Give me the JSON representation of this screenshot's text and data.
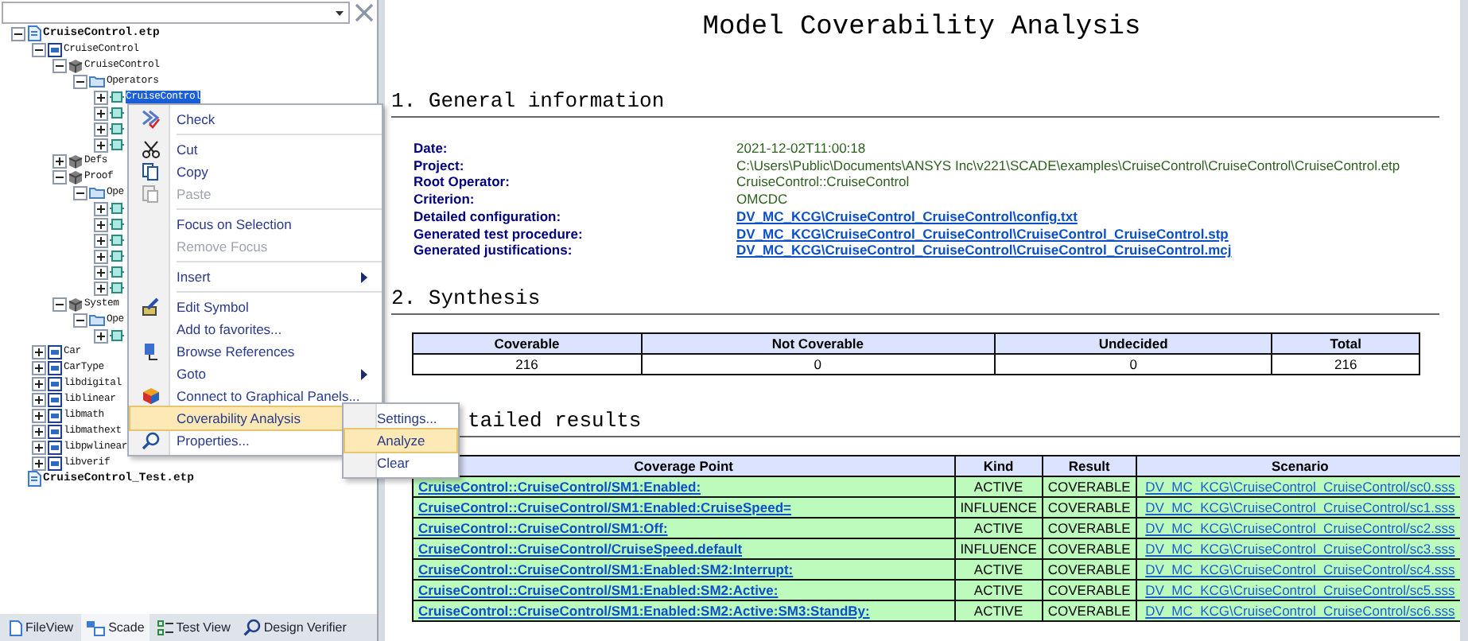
{
  "explorer": {
    "tree": [
      {
        "kind": "file",
        "label": "CruiseControl.etp",
        "expanded": true,
        "selected": false,
        "children": [
          {
            "kind": "package",
            "label": "CruiseControl",
            "expanded": true,
            "selected": false,
            "children": [
              {
                "kind": "model",
                "label": "CruiseControl",
                "expanded": true,
                "selected": false,
                "children": [
                  {
                    "kind": "folder",
                    "label": "Operators",
                    "expanded": true,
                    "selected": false,
                    "children": [
                      {
                        "kind": "operator",
                        "label": "CruiseControl",
                        "expanded": false,
                        "selected": true
                      },
                      {
                        "kind": "operator",
                        "expanded": false,
                        "selected": false
                      },
                      {
                        "kind": "operator",
                        "expanded": false,
                        "selected": false
                      },
                      {
                        "kind": "operator",
                        "expanded": false,
                        "selected": false
                      }
                    ]
                  }
                ]
              },
              {
                "kind": "model",
                "label": "Defs",
                "expanded": false,
                "selected": false
              },
              {
                "kind": "model",
                "label": "Proof",
                "expanded": true,
                "selected": false,
                "children": [
                  {
                    "kind": "folder",
                    "label": "Ope",
                    "expanded": true,
                    "selected": false,
                    "children": [
                      {
                        "kind": "operator",
                        "expanded": false,
                        "selected": false
                      },
                      {
                        "kind": "operator",
                        "expanded": false,
                        "selected": false
                      },
                      {
                        "kind": "operator",
                        "expanded": false,
                        "selected": false
                      },
                      {
                        "kind": "operator",
                        "expanded": false,
                        "selected": false
                      },
                      {
                        "kind": "operator",
                        "expanded": false,
                        "selected": false
                      },
                      {
                        "kind": "operator",
                        "expanded": false,
                        "selected": false
                      }
                    ]
                  }
                ]
              },
              {
                "kind": "model",
                "label": "System",
                "expanded": true,
                "selected": false,
                "children": [
                  {
                    "kind": "folder",
                    "label": "Ope",
                    "expanded": true,
                    "selected": false,
                    "children": [
                      {
                        "kind": "operator",
                        "expanded": false,
                        "selected": false
                      }
                    ]
                  }
                ]
              }
            ]
          },
          {
            "kind": "package",
            "label": "Car",
            "expanded": false,
            "selected": false
          },
          {
            "kind": "package",
            "label": "CarType",
            "expanded": false,
            "selected": false
          },
          {
            "kind": "package",
            "label": "libdigital",
            "expanded": false,
            "selected": false
          },
          {
            "kind": "package",
            "label": "liblinear",
            "expanded": false,
            "selected": false
          },
          {
            "kind": "package",
            "label": "libmath",
            "expanded": false,
            "selected": false
          },
          {
            "kind": "package",
            "label": "libmathext",
            "expanded": false,
            "selected": false
          },
          {
            "kind": "package",
            "label": "libpwlinear",
            "expanded": false,
            "selected": false
          },
          {
            "kind": "package",
            "label": "libverif",
            "expanded": false,
            "selected": false
          }
        ]
      },
      {
        "kind": "file",
        "label": "CruiseControl_Test.etp",
        "selected": false
      }
    ],
    "tabs": [
      {
        "label": "FileView",
        "selected": false
      },
      {
        "label": "Scade",
        "selected": true
      },
      {
        "label": "Test View",
        "selected": false
      },
      {
        "label": "Design Verifier",
        "selected": false
      }
    ]
  },
  "context_menu": {
    "items": [
      {
        "kind": "item",
        "label": "Check",
        "disabled": false,
        "selected": false,
        "has_submenu": false
      },
      {
        "kind": "separator"
      },
      {
        "kind": "item",
        "label": "Cut",
        "disabled": false,
        "selected": false,
        "has_submenu": false
      },
      {
        "kind": "item",
        "label": "Copy",
        "disabled": false,
        "selected": false,
        "has_submenu": false
      },
      {
        "kind": "item",
        "label": "Paste",
        "disabled": true,
        "selected": false,
        "has_submenu": false
      },
      {
        "kind": "separator"
      },
      {
        "kind": "item",
        "label": "Focus on Selection",
        "disabled": false,
        "selected": false,
        "has_submenu": false
      },
      {
        "kind": "item",
        "label": "Remove Focus",
        "disabled": true,
        "selected": false,
        "has_submenu": false
      },
      {
        "kind": "separator"
      },
      {
        "kind": "item",
        "label": "Insert",
        "disabled": false,
        "selected": false,
        "has_submenu": true
      },
      {
        "kind": "separator"
      },
      {
        "kind": "item",
        "label": "Edit Symbol",
        "disabled": false,
        "selected": false,
        "has_submenu": false
      },
      {
        "kind": "item",
        "label": "Add to favorites...",
        "disabled": false,
        "selected": false,
        "has_submenu": false
      },
      {
        "kind": "item",
        "label": "Browse References",
        "disabled": false,
        "selected": false,
        "has_submenu": false
      },
      {
        "kind": "item",
        "label": "Goto",
        "disabled": false,
        "selected": false,
        "has_submenu": true
      },
      {
        "kind": "item",
        "label": "Connect to Graphical Panels...",
        "disabled": false,
        "selected": false,
        "has_submenu": false
      },
      {
        "kind": "item",
        "label": "Coverability Analysis",
        "disabled": false,
        "selected": true,
        "has_submenu": true,
        "submenu": [
          {
            "label": "Settings...",
            "selected": false
          },
          {
            "label": "Analyze",
            "selected": true
          },
          {
            "label": "Clear",
            "selected": false
          }
        ]
      },
      {
        "kind": "item",
        "label": "Properties...",
        "disabled": false,
        "selected": false,
        "has_submenu": false
      }
    ]
  },
  "report": {
    "title": "Model Coverability Analysis",
    "general": {
      "heading": "1. General information",
      "fields": [
        {
          "label": "Date:",
          "value": "2021-12-02T11:00:18",
          "kind": "text"
        },
        {
          "label": "Project:",
          "value": "C:\\Users\\Public\\Documents\\ANSYS Inc\\v221\\SCADE\\examples\\CruiseControl\\CruiseControl\\CruiseControl.etp",
          "kind": "text"
        },
        {
          "label": "Root Operator:",
          "value": "CruiseControl::CruiseControl",
          "kind": "text"
        },
        {
          "label": "Criterion:",
          "value": "OMCDC",
          "kind": "text"
        },
        {
          "label": "Detailed configuration:",
          "value": "DV_MC_KCG\\CruiseControl_CruiseControl\\config.txt",
          "kind": "link"
        },
        {
          "label": "Generated test procedure:",
          "value": "DV_MC_KCG\\CruiseControl_CruiseControl\\CruiseControl_CruiseControl.stp",
          "kind": "link"
        },
        {
          "label": "Generated justifications:",
          "value": "DV_MC_KCG\\CruiseControl_CruiseControl\\CruiseControl_CruiseControl.mcj",
          "kind": "link"
        }
      ]
    },
    "synthesis": {
      "heading": "2. Synthesis",
      "columns": [
        "Coverable",
        "Not Coverable",
        "Undecided",
        "Total"
      ],
      "rows": [
        [
          "216",
          "0",
          "0",
          "216"
        ]
      ]
    },
    "detailed": {
      "heading": "tailed results",
      "columns": [
        "Coverage Point",
        "Kind",
        "Result",
        "Scenario"
      ],
      "rows": [
        {
          "coverage_point": "CruiseControl::CruiseControl/SM1:Enabled:",
          "kind": "ACTIVE",
          "result": "COVERABLE",
          "scenario": "DV_MC_KCG\\CruiseControl_CruiseControl/sc0.sss"
        },
        {
          "coverage_point": "CruiseControl::CruiseControl/SM1:Enabled:CruiseSpeed=",
          "kind": "INFLUENCE",
          "result": "COVERABLE",
          "scenario": "DV_MC_KCG\\CruiseControl_CruiseControl/sc1.sss"
        },
        {
          "coverage_point": "CruiseControl::CruiseControl/SM1:Off:",
          "kind": "ACTIVE",
          "result": "COVERABLE",
          "scenario": "DV_MC_KCG\\CruiseControl_CruiseControl/sc2.sss"
        },
        {
          "coverage_point": "CruiseControl::CruiseControl/CruiseSpeed.default",
          "kind": "INFLUENCE",
          "result": "COVERABLE",
          "scenario": "DV_MC_KCG\\CruiseControl_CruiseControl/sc3.sss"
        },
        {
          "coverage_point": "CruiseControl::CruiseControl/SM1:Enabled:SM2:Interrupt:",
          "kind": "ACTIVE",
          "result": "COVERABLE",
          "scenario": "DV_MC_KCG\\CruiseControl_CruiseControl/sc4.sss"
        },
        {
          "coverage_point": "CruiseControl::CruiseControl/SM1:Enabled:SM2:Active:",
          "kind": "ACTIVE",
          "result": "COVERABLE",
          "scenario": "DV_MC_KCG\\CruiseControl_CruiseControl/sc5.sss"
        },
        {
          "coverage_point": "CruiseControl::CruiseControl/SM1:Enabled:SM2:Active:SM3:StandBy:",
          "kind": "ACTIVE",
          "result": "COVERABLE",
          "scenario": "DV_MC_KCG\\CruiseControl_CruiseControl/sc6.sss"
        }
      ]
    }
  }
}
